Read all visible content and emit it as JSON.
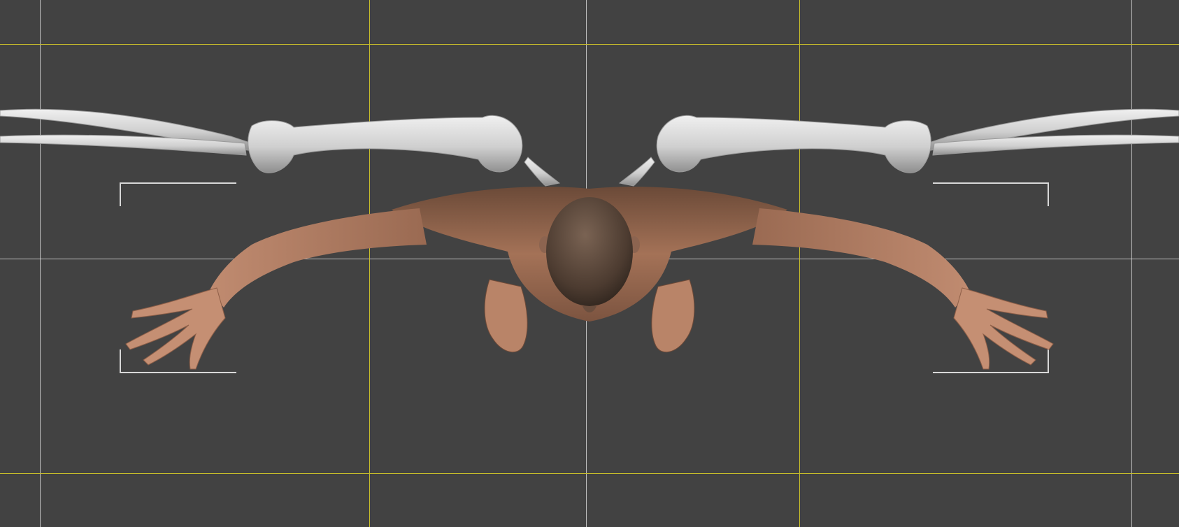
{
  "viewport": {
    "view": "top",
    "background_color": "#424242",
    "guide_colors": {
      "center": "#e6e6e6",
      "safe_frame": "#c7bd2a",
      "corner_brackets": "#d8d8d8"
    },
    "figure": {
      "subject": "human-figure-arms-outstretched",
      "skin_color": "#a47257",
      "wing_bone_color": "#d9d9d9"
    }
  }
}
